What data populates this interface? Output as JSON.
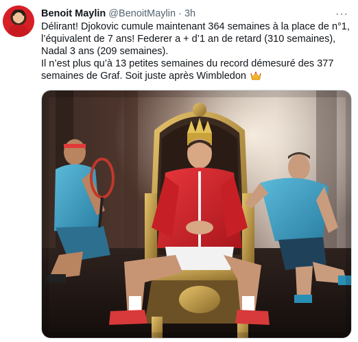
{
  "tweet": {
    "author_name": "Benoit Maylin",
    "author_handle": "@BenoitMaylin",
    "separator": "·",
    "time": "3h",
    "more_label": "···",
    "paragraph_1": "Délirant! Djokovic cumule maintenant 364 semaines à la place de n°1, l’équivalent de 7 ans! Federer a + d’1 an de retard (310 semaines), Nadal 3 ans (209 semaines).",
    "paragraph_2": "Il n’est plus qu’à 13 petites semaines du record démesuré des 377 semaines de Graf. Soit juste après Wimbledon",
    "emoji_icon": "crown-icon"
  },
  "media": {
    "description_icon": "photo-image"
  },
  "colors": {
    "text_primary": "#0f1419",
    "text_secondary": "#536471",
    "border": "#cfd9de",
    "jacket_red": "#d8272e",
    "shirt_blue": "#3fa3c9",
    "gold": "#c9a24a"
  }
}
